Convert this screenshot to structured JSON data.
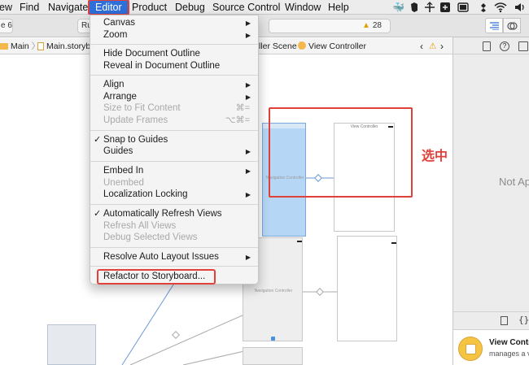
{
  "menubar": {
    "items": [
      "ew",
      "Find",
      "Navigate",
      "Editor",
      "Product",
      "Debug",
      "Source Control",
      "Window",
      "Help"
    ],
    "status_icons": [
      "docker-whale-icon",
      "evernote-icon",
      "move-icon",
      "bluetooth-grid-icon",
      "screen-icon",
      "dropbox-icon",
      "wifi-icon",
      "volume-icon"
    ]
  },
  "toolbar": {
    "scheme_fragment": "e 6",
    "run_fragment": "Ru",
    "warning_count": "28"
  },
  "jumpbar": {
    "folder": "Main",
    "file": "Main.storybo",
    "scene": "ller Scene",
    "controller": "View Controller",
    "warning_symbol": "⚠"
  },
  "editor_menu": {
    "items": [
      {
        "label": "Canvas",
        "submenu": true
      },
      {
        "label": "Zoom",
        "submenu": true
      },
      {
        "label": "Hide Document Outline"
      },
      {
        "label": "Reveal in Document Outline"
      },
      {
        "label": "Align",
        "submenu": true
      },
      {
        "label": "Arrange",
        "submenu": true
      },
      {
        "label": "Size to Fit Content",
        "disabled": true,
        "shortcut": "⌘="
      },
      {
        "label": "Update Frames",
        "disabled": true,
        "shortcut": "⌥⌘="
      },
      {
        "label": "Snap to Guides",
        "checked": true
      },
      {
        "label": "Guides",
        "submenu": true
      },
      {
        "label": "Embed In",
        "submenu": true
      },
      {
        "label": "Unembed",
        "disabled": true
      },
      {
        "label": "Localization Locking",
        "submenu": true
      },
      {
        "label": "Automatically Refresh Views",
        "checked": true
      },
      {
        "label": "Refresh All Views",
        "disabled": true
      },
      {
        "label": "Debug Selected Views",
        "disabled": true
      },
      {
        "label": "Resolve Auto Layout Issues",
        "submenu": true
      },
      {
        "label": "Refactor to Storyboard..."
      }
    ]
  },
  "canvas": {
    "nav_controller_label": "Navigation Controller",
    "view_controller_label": "View Controller"
  },
  "inspector": {
    "not_applicable": "Not Ap",
    "library_title": "View Contro",
    "library_subtitle": "manages a vi"
  },
  "annotation": {
    "label": "选中",
    "color": "#e0413a"
  },
  "colors": {
    "menu_highlight": "#2f6fd8",
    "annotation_red": "#e0413a",
    "storyboard_icon": "#f5c542",
    "selection_blue": "#b6d6f5"
  }
}
